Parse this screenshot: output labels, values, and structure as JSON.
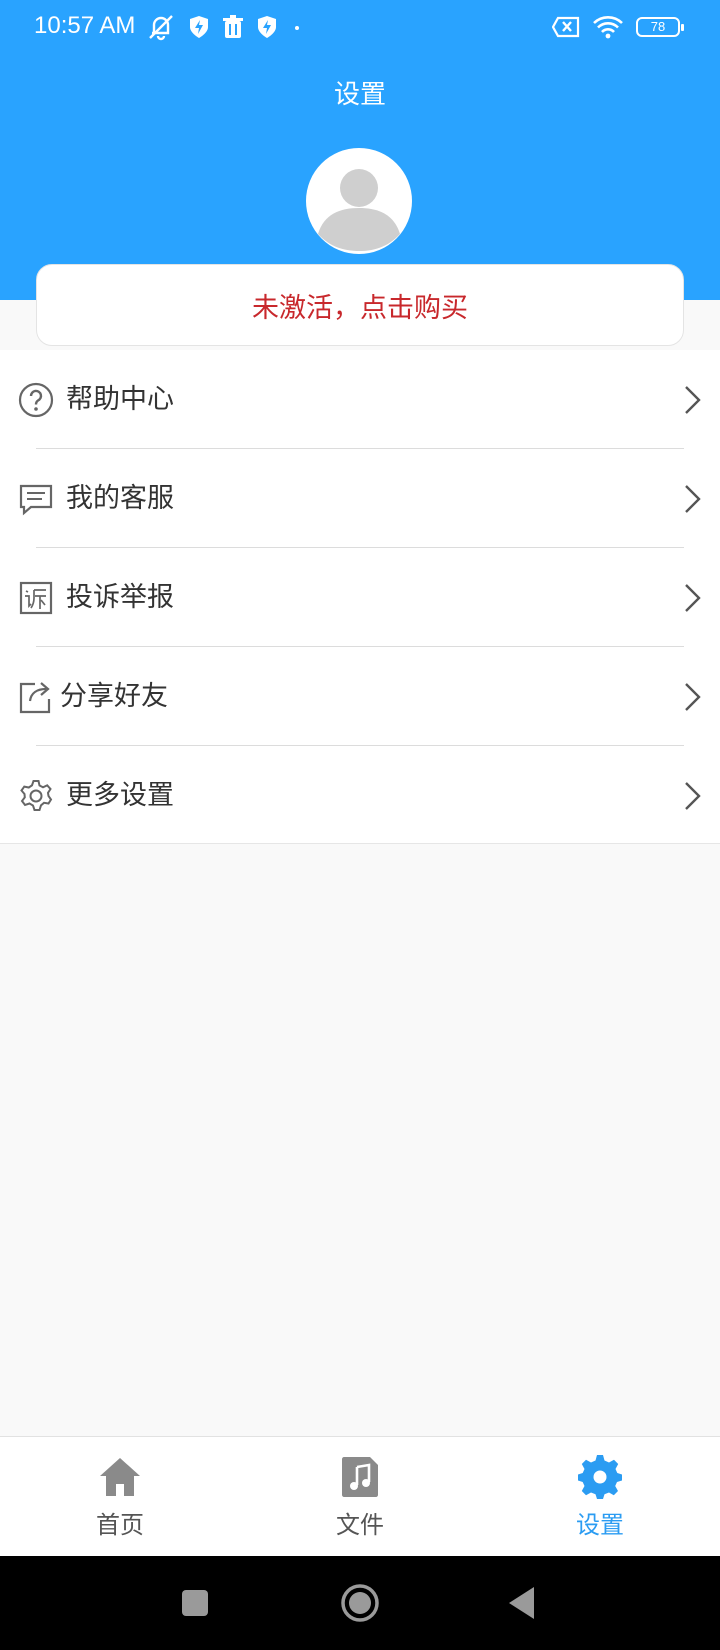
{
  "status_bar": {
    "time": "10:57 AM",
    "battery": "78"
  },
  "header": {
    "title": "设置"
  },
  "activation": {
    "label": "未激活，点击购买",
    "color": "#c8282c"
  },
  "menu": {
    "items": [
      {
        "label": "帮助中心",
        "icon": "help-circle-icon"
      },
      {
        "label": "我的客服",
        "icon": "chat-icon"
      },
      {
        "label": "投诉举报",
        "icon": "complaint-icon"
      },
      {
        "label": "分享好友",
        "icon": "share-icon"
      },
      {
        "label": "更多设置",
        "icon": "gear-icon"
      }
    ]
  },
  "bottom_nav": {
    "items": [
      {
        "label": "首页",
        "icon": "home-icon"
      },
      {
        "label": "文件",
        "icon": "music-file-icon"
      },
      {
        "label": "设置",
        "icon": "gear-icon",
        "active": true
      }
    ]
  },
  "colors": {
    "primary": "#29a3ff",
    "active_tab": "#2b9cf2",
    "background": "#f9f9f9"
  }
}
